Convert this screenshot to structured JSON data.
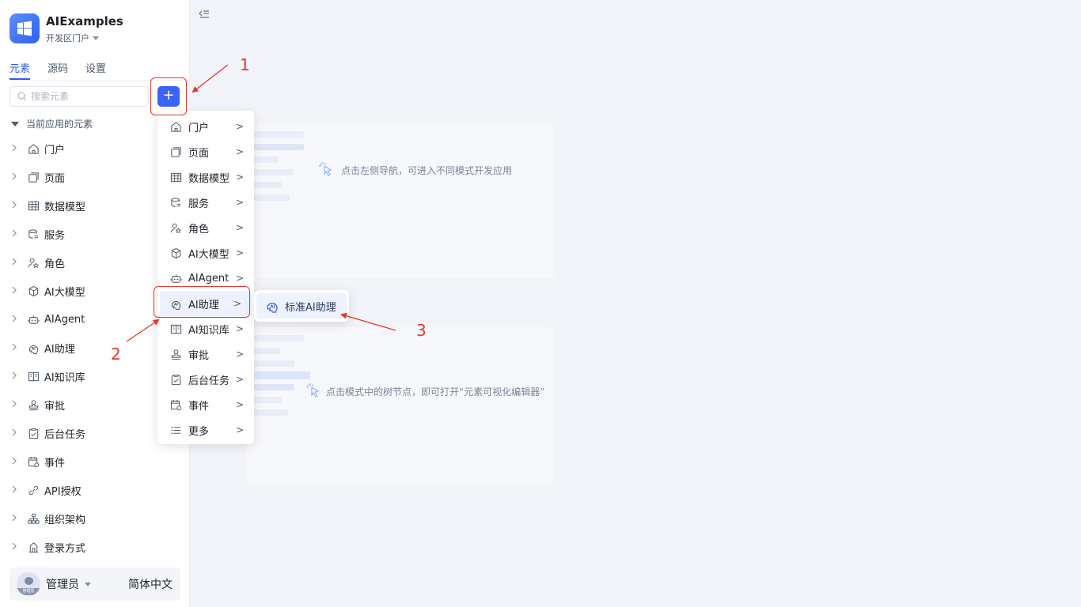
{
  "app": {
    "name": "AIExamples",
    "portal": "开发区门户"
  },
  "tabs": [
    "元素",
    "源码",
    "设置"
  ],
  "search": {
    "placeholder": "搜索元素"
  },
  "add_button": {
    "label": "+"
  },
  "section": {
    "label": "当前应用的元素"
  },
  "tree": [
    {
      "label": "门户",
      "icon": "home-icon"
    },
    {
      "label": "页面",
      "icon": "page-icon"
    },
    {
      "label": "数据模型",
      "icon": "table-icon"
    },
    {
      "label": "服务",
      "icon": "database-icon"
    },
    {
      "label": "角色",
      "icon": "role-icon"
    },
    {
      "label": "AI大模型",
      "icon": "cube-icon"
    },
    {
      "label": "AIAgent",
      "icon": "robot-icon"
    },
    {
      "label": "AI助理",
      "icon": "ai-assistant-icon"
    },
    {
      "label": "AI知识库",
      "icon": "book-icon"
    },
    {
      "label": "审批",
      "icon": "stamp-icon"
    },
    {
      "label": "后台任务",
      "icon": "task-icon"
    },
    {
      "label": "事件",
      "icon": "event-icon"
    },
    {
      "label": "API授权",
      "icon": "link-icon"
    },
    {
      "label": "组织架构",
      "icon": "org-icon"
    },
    {
      "label": "登录方式",
      "icon": "login-icon"
    }
  ],
  "menu": [
    {
      "label": "门户",
      "icon": "home-icon"
    },
    {
      "label": "页面",
      "icon": "page-icon"
    },
    {
      "label": "数据模型",
      "icon": "table-icon"
    },
    {
      "label": "服务",
      "icon": "database-icon"
    },
    {
      "label": "角色",
      "icon": "role-icon"
    },
    {
      "label": "AI大模型",
      "icon": "cube-icon"
    },
    {
      "label": "AIAgent",
      "icon": "robot-icon"
    },
    {
      "label": "AI助理",
      "icon": "ai-assistant-icon"
    },
    {
      "label": "AI知识库",
      "icon": "book-icon"
    },
    {
      "label": "审批",
      "icon": "stamp-icon"
    },
    {
      "label": "后台任务",
      "icon": "task-icon"
    },
    {
      "label": "事件",
      "icon": "event-icon"
    },
    {
      "label": "更多",
      "icon": "list-icon"
    }
  ],
  "menu_arrow": ">",
  "submenu": {
    "label": "标准AI助理"
  },
  "hints": {
    "nav": "点击左侧导航，可进入不同模式开发应用",
    "tree": "点击模式中的树节点，即可打开“元素可视化编辑器”"
  },
  "footer": {
    "user": "管理员",
    "avatar_label": "管理员",
    "language": "简体中文"
  },
  "annotations": [
    "1",
    "2",
    "3"
  ],
  "colors": {
    "accent": "#3a64f5",
    "annotation": "#e8362a"
  }
}
